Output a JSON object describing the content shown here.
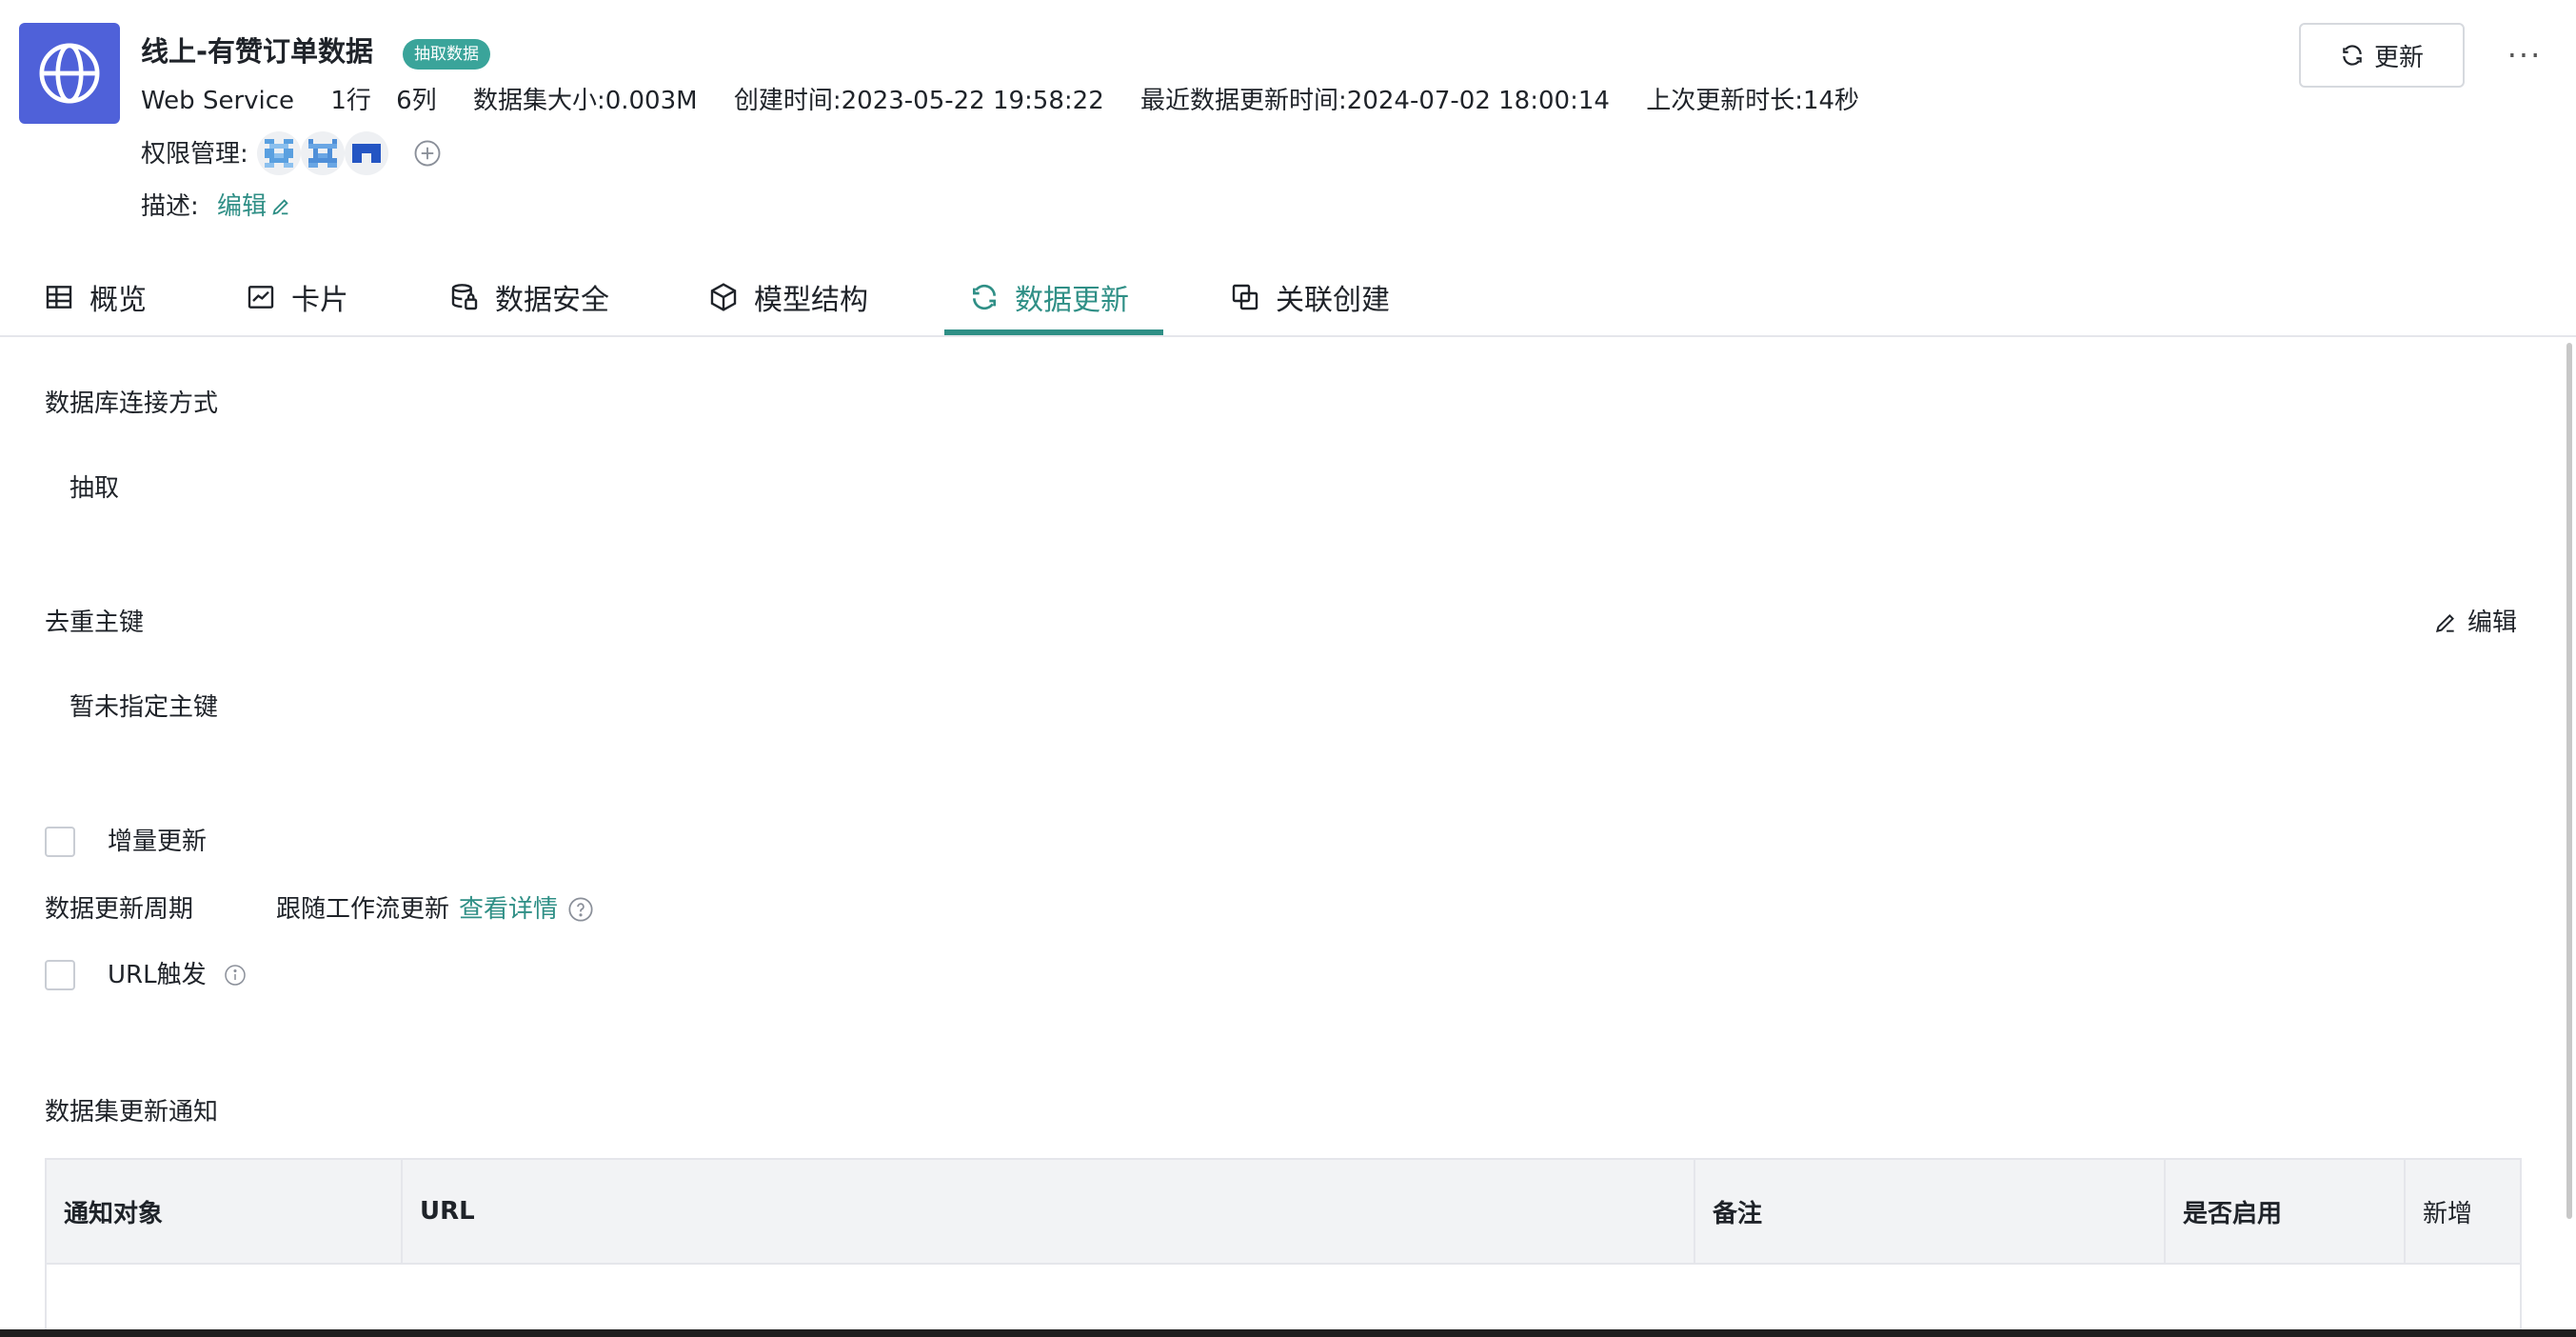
{
  "header": {
    "title": "线上-有赞订单数据",
    "badge": "抽取数据",
    "app_icon": "globe-icon",
    "meta": {
      "source": "Web Service",
      "rows": "1行",
      "cols": "6列",
      "size": "数据集大小:0.003M",
      "created": "创建时间:2023-05-22 19:58:22",
      "updated": "最近数据更新时间:2024-07-02 18:00:14",
      "duration": "上次更新时长:14秒"
    },
    "permission_label": "权限管理:",
    "description_label": "描述:",
    "description_edit": "编辑",
    "refresh_label": "更新",
    "more_label": "···"
  },
  "tabs": [
    {
      "label": "概览",
      "icon": "table-icon"
    },
    {
      "label": "卡片",
      "icon": "chart-card-icon"
    },
    {
      "label": "数据安全",
      "icon": "database-lock-icon"
    },
    {
      "label": "模型结构",
      "icon": "cube-icon"
    },
    {
      "label": "数据更新",
      "icon": "refresh-icon",
      "active": true
    },
    {
      "label": "关联创建",
      "icon": "link-create-icon"
    }
  ],
  "connection": {
    "label": "数据库连接方式",
    "value": "抽取"
  },
  "dedup": {
    "label": "去重主键",
    "value": "暂未指定主键",
    "edit_label": "编辑"
  },
  "incremental": {
    "label": "增量更新",
    "checked": false
  },
  "period": {
    "label": "数据更新周期",
    "value": "跟随工作流更新",
    "link": "查看详情"
  },
  "url_trigger": {
    "label": "URL触发",
    "checked": false
  },
  "notification": {
    "label": "数据集更新通知",
    "columns": [
      "通知对象",
      "URL",
      "备注",
      "是否启用"
    ],
    "add_label": "新增"
  },
  "colors": {
    "accent": "#2f8f86",
    "app_icon_bg": "#4f61d9",
    "badge_bg": "#3aa49a"
  }
}
